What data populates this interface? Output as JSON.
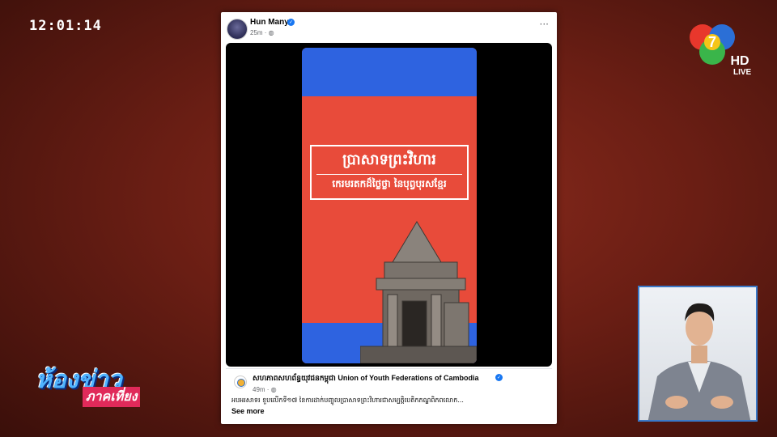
{
  "broadcast": {
    "clock": "12:01:14",
    "channel_tag": "LIVE",
    "show_title_line1": "ห้องข่าว",
    "show_title_line2": "ภาคเที่ยง"
  },
  "post": {
    "author": "Hun Many",
    "time": "25m · ",
    "more_label": "···",
    "video": {
      "title_line1": "ប្រាសាទព្រះវិហារ",
      "title_line2": "កេរមរតកដ៏ថ្លៃថ្លា នៃបុព្វបុរសខ្មែរ"
    },
    "shared": {
      "page_name": "សហភាពសហព័ន្ធយុវជនកម្ពុជា Union of Youth Federations of Cambodia",
      "time": "49m · ",
      "text": "អបអរសាទរ ខួបលើកទី១៧ នៃការដាក់បញ្ចូលប្រាសាទព្រះវិហារជាសម្បត្តិបេតិកភណ្ឌពិភពលោក...",
      "see_more": "See more"
    }
  },
  "icons": {
    "verified": "verified-badge-icon",
    "globe": "globe-icon",
    "more": "more-options-icon"
  },
  "colors": {
    "flag_blue": "#2e63e0",
    "flag_red": "#e84b3a",
    "facebook_blue": "#1877f2"
  }
}
